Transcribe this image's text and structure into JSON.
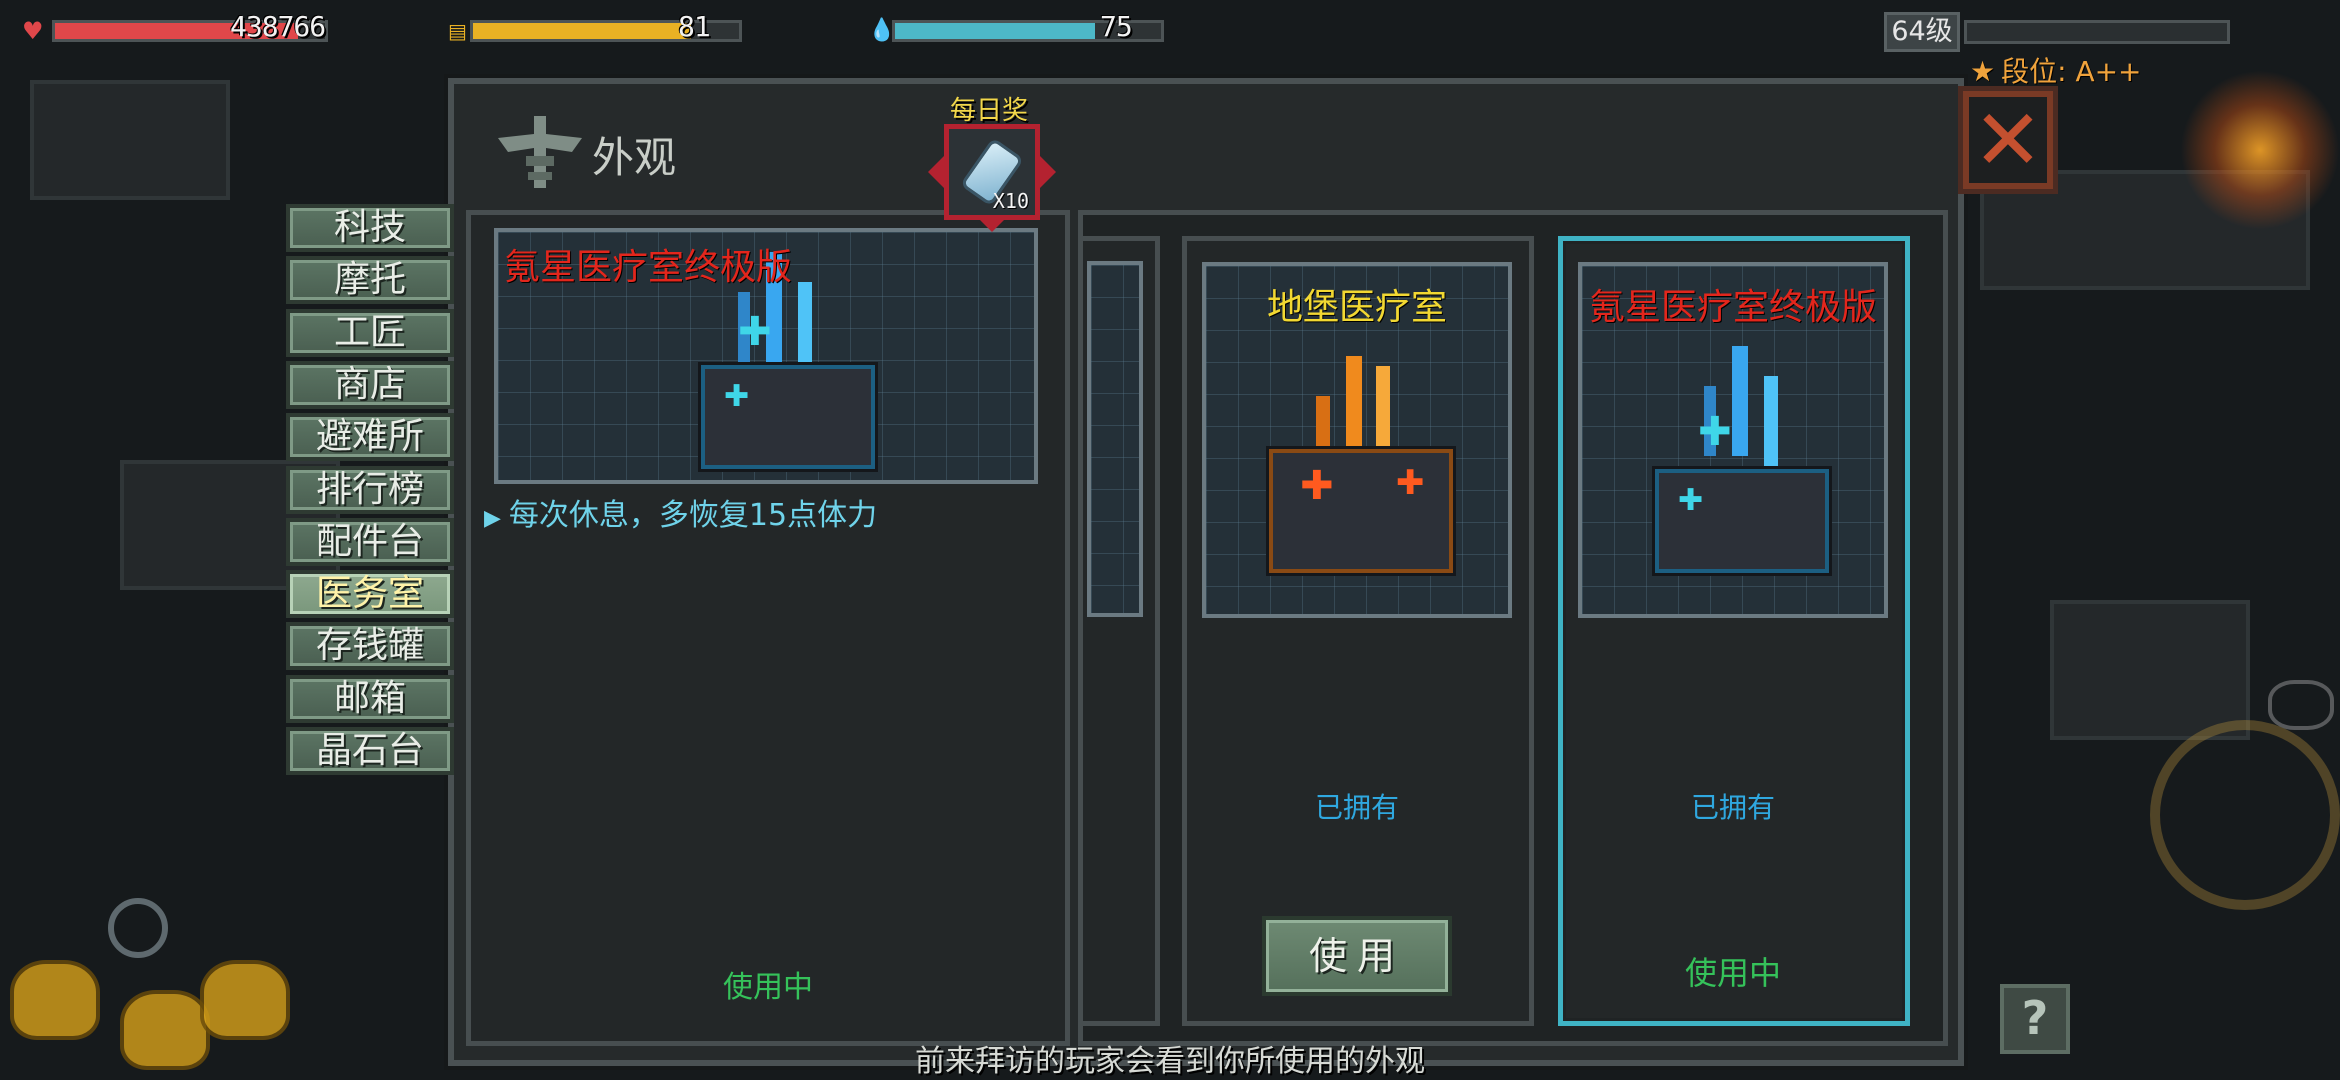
{
  "hud": {
    "hp_value": "438766",
    "energy_value": "81",
    "water_value": "75",
    "hp_fill": 0.9,
    "energy_fill": 0.82,
    "water_fill": 0.75,
    "colors": {
      "hp": "#e0474a",
      "energy": "#e9b124",
      "water": "#4db8c8"
    },
    "level": "64级",
    "rank": "段位: A++"
  },
  "panel": {
    "title": "外观",
    "close_label": "✕"
  },
  "nav": {
    "items": [
      {
        "label": "科技"
      },
      {
        "label": "摩托"
      },
      {
        "label": "工匠"
      },
      {
        "label": "商店"
      },
      {
        "label": "避难所"
      },
      {
        "label": "排行榜"
      },
      {
        "label": "配件台"
      },
      {
        "label": "医务室",
        "active": true
      },
      {
        "label": "存钱罐"
      },
      {
        "label": "邮箱"
      },
      {
        "label": "晶石台"
      }
    ]
  },
  "daily": {
    "label": "每日奖",
    "quantity": "X10"
  },
  "detail": {
    "name": "氪星医疗室终极版",
    "description": "每次休息，多恢复15点体力",
    "status": "使用中"
  },
  "skins": [
    {
      "name": "地堡医疗室",
      "name_color": "#f2d832",
      "owned": "已拥有",
      "button": "使用"
    },
    {
      "name": "氪星医疗室终极版",
      "name_color": "#e3261c",
      "owned": "已拥有",
      "status": "使用中"
    }
  ],
  "footer": {
    "hint": "前来拜访的玩家会看到你所使用的外观",
    "help": "?"
  }
}
